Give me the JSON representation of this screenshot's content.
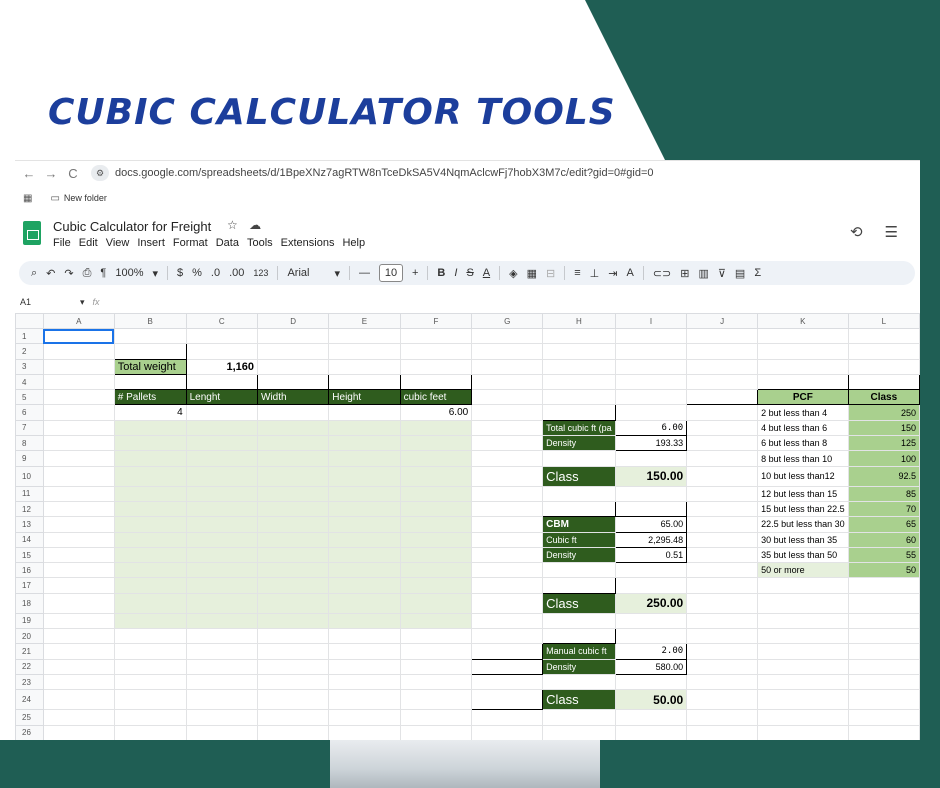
{
  "headline": "CUBIC CALCULATOR TOOLS",
  "browser": {
    "nav": {
      "back": "←",
      "forward": "→",
      "reload": "C"
    },
    "url": "docs.google.com/spreadsheets/d/1BpeXNz7agRTW8nTceDkSA5V4NqmAclcwFj7hobX3M7c/edit?gid=0#gid=0",
    "bookmark": "New folder"
  },
  "app": {
    "title": "Cubic Calculator for Freight",
    "menu": [
      "File",
      "Edit",
      "View",
      "Insert",
      "Format",
      "Data",
      "Tools",
      "Extensions",
      "Help"
    ]
  },
  "toolbar": {
    "zoom": "100%",
    "currency": "$",
    "percent": "%",
    "dec_decrease": ".0",
    "dec_increase": ".00",
    "num_format": "123",
    "font": "Arial",
    "font_size": "10",
    "minus": "—",
    "plus": "+",
    "bold": "B",
    "italic": "I",
    "strike": "S",
    "text_color": "A",
    "sum": "Σ"
  },
  "formula_bar": {
    "cell_ref": "A1",
    "fx": "fx"
  },
  "columns": [
    "A",
    "B",
    "C",
    "D",
    "E",
    "F",
    "G",
    "H",
    "I",
    "J",
    "K",
    "L"
  ],
  "cells": {
    "total_weight_label": "Total weight",
    "total_weight_value": "1,160",
    "hdr_pallets": "# Pallets",
    "hdr_length": "Lenght",
    "hdr_width": "Width",
    "hdr_height": "Height",
    "hdr_cubic": "cubic feet",
    "pallets_value": "4",
    "cubic_value": "6.00",
    "total_cubic_label": "Total cubic ft (pa",
    "total_cubic_value": "6.00",
    "density1_label": "Density",
    "density1_value": "193.33",
    "class1_label": "Class",
    "class1_value": "150.00",
    "cbm_label": "CBM",
    "cbm_value": "65.00",
    "cubicft_label": "Cubic ft",
    "cubicft_value": "2,295.48",
    "density2_label": "Density",
    "density2_value": "0.51",
    "class2_label": "Class",
    "class2_value": "250.00",
    "manual_label": "Manual cubic ft",
    "manual_value": "2.00",
    "density3_label": "Density",
    "density3_value": "580.00",
    "class3_label": "Class",
    "class3_value": "50.00",
    "pcf_header": "PCF",
    "class_header": "Class"
  },
  "pcf_table": [
    {
      "pcf": "2 but less than 4",
      "class": "250"
    },
    {
      "pcf": "4 but less than 6",
      "class": "150"
    },
    {
      "pcf": "6 but less than 8",
      "class": "125"
    },
    {
      "pcf": "8 but less than 10",
      "class": "100"
    },
    {
      "pcf": "10 but less than12",
      "class": "92.5"
    },
    {
      "pcf": "12 but less than 15",
      "class": "85"
    },
    {
      "pcf": "15 but less than 22.5",
      "class": "70"
    },
    {
      "pcf": "22.5 but less than 30",
      "class": "65"
    },
    {
      "pcf": "30 but less than 35",
      "class": "60"
    },
    {
      "pcf": "35 but less than 50",
      "class": "55"
    },
    {
      "pcf": "50 or more",
      "class": "50"
    }
  ],
  "colors": {
    "dark_green": "#2f5c1e",
    "mid_green": "#a9d08e",
    "light_green": "#e6f0dc",
    "headline_blue": "#1c3e9c",
    "bg_teal": "#1f5e54"
  }
}
